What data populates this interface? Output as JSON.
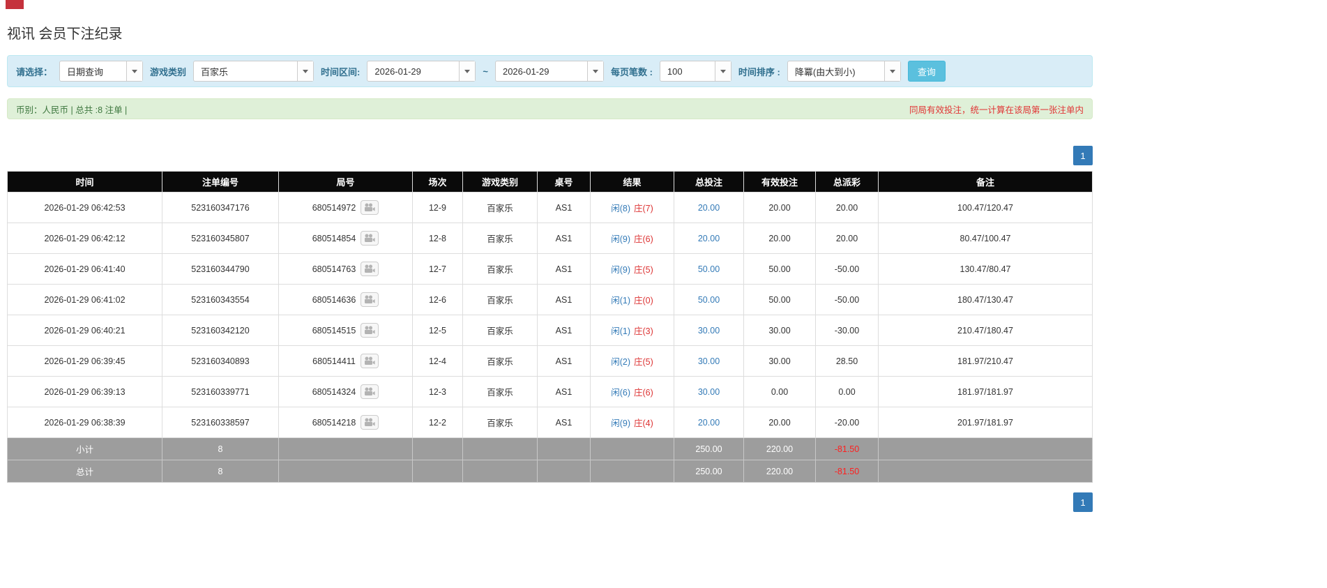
{
  "page": {
    "title": "视讯 会员下注纪录"
  },
  "filters": {
    "query_type_label": "请选择：",
    "query_type_value": "日期查询",
    "game_type_label": "游戏类别",
    "game_type_value": "百家乐",
    "date_range_label": "时间区间:",
    "date_from": "2026-01-29",
    "date_separator": "~",
    "date_to": "2026-01-29",
    "page_size_label": "每页笔数 :",
    "page_size_value": "100",
    "sort_label": "时间排序 :",
    "sort_value": "降冪(由大到小)",
    "search_button": "查询"
  },
  "summary": {
    "left": "币别：人民币 | 总共 :8 注单 |",
    "right": "同局有效投注，统一计算在该局第一张注单内"
  },
  "pagination": {
    "page": "1"
  },
  "table": {
    "headers": [
      "时间",
      "注单编号",
      "局号",
      "场次",
      "游戏类别",
      "桌号",
      "结果",
      "总投注",
      "有效投注",
      "总派彩",
      "备注"
    ],
    "rows": [
      {
        "time": "2026-01-29 06:42:53",
        "bet_id": "523160347176",
        "round_id": "680514972",
        "session": "12-9",
        "game": "百家乐",
        "table_no": "AS1",
        "result_player": "闲(8)",
        "result_banker": "庄(7)",
        "total_bet": "20.00",
        "valid_bet": "20.00",
        "payout": "20.00",
        "note": "100.47/120.47"
      },
      {
        "time": "2026-01-29 06:42:12",
        "bet_id": "523160345807",
        "round_id": "680514854",
        "session": "12-8",
        "game": "百家乐",
        "table_no": "AS1",
        "result_player": "闲(9)",
        "result_banker": "庄(6)",
        "total_bet": "20.00",
        "valid_bet": "20.00",
        "payout": "20.00",
        "note": "80.47/100.47"
      },
      {
        "time": "2026-01-29 06:41:40",
        "bet_id": "523160344790",
        "round_id": "680514763",
        "session": "12-7",
        "game": "百家乐",
        "table_no": "AS1",
        "result_player": "闲(9)",
        "result_banker": "庄(5)",
        "total_bet": "50.00",
        "valid_bet": "50.00",
        "payout": "-50.00",
        "note": "130.47/80.47"
      },
      {
        "time": "2026-01-29 06:41:02",
        "bet_id": "523160343554",
        "round_id": "680514636",
        "session": "12-6",
        "game": "百家乐",
        "table_no": "AS1",
        "result_player": "闲(1)",
        "result_banker": "庄(0)",
        "total_bet": "50.00",
        "valid_bet": "50.00",
        "payout": "-50.00",
        "note": "180.47/130.47"
      },
      {
        "time": "2026-01-29 06:40:21",
        "bet_id": "523160342120",
        "round_id": "680514515",
        "session": "12-5",
        "game": "百家乐",
        "table_no": "AS1",
        "result_player": "闲(1)",
        "result_banker": "庄(3)",
        "total_bet": "30.00",
        "valid_bet": "30.00",
        "payout": "-30.00",
        "note": "210.47/180.47"
      },
      {
        "time": "2026-01-29 06:39:45",
        "bet_id": "523160340893",
        "round_id": "680514411",
        "session": "12-4",
        "game": "百家乐",
        "table_no": "AS1",
        "result_player": "闲(2)",
        "result_banker": "庄(5)",
        "total_bet": "30.00",
        "valid_bet": "30.00",
        "payout": "28.50",
        "note": "181.97/210.47"
      },
      {
        "time": "2026-01-29 06:39:13",
        "bet_id": "523160339771",
        "round_id": "680514324",
        "session": "12-3",
        "game": "百家乐",
        "table_no": "AS1",
        "result_player": "闲(6)",
        "result_banker": "庄(6)",
        "total_bet": "30.00",
        "valid_bet": "0.00",
        "payout": "0.00",
        "note": "181.97/181.97"
      },
      {
        "time": "2026-01-29 06:38:39",
        "bet_id": "523160338597",
        "round_id": "680514218",
        "session": "12-2",
        "game": "百家乐",
        "table_no": "AS1",
        "result_player": "闲(9)",
        "result_banker": "庄(4)",
        "total_bet": "20.00",
        "valid_bet": "20.00",
        "payout": "-20.00",
        "note": "201.97/181.97"
      }
    ],
    "subtotal": {
      "label": "小计",
      "count": "8",
      "total_bet": "250.00",
      "valid_bet": "220.00",
      "payout": "-81.50"
    },
    "total": {
      "label": "总计",
      "count": "8",
      "total_bet": "250.00",
      "valid_bet": "220.00",
      "payout": "-81.50"
    }
  }
}
